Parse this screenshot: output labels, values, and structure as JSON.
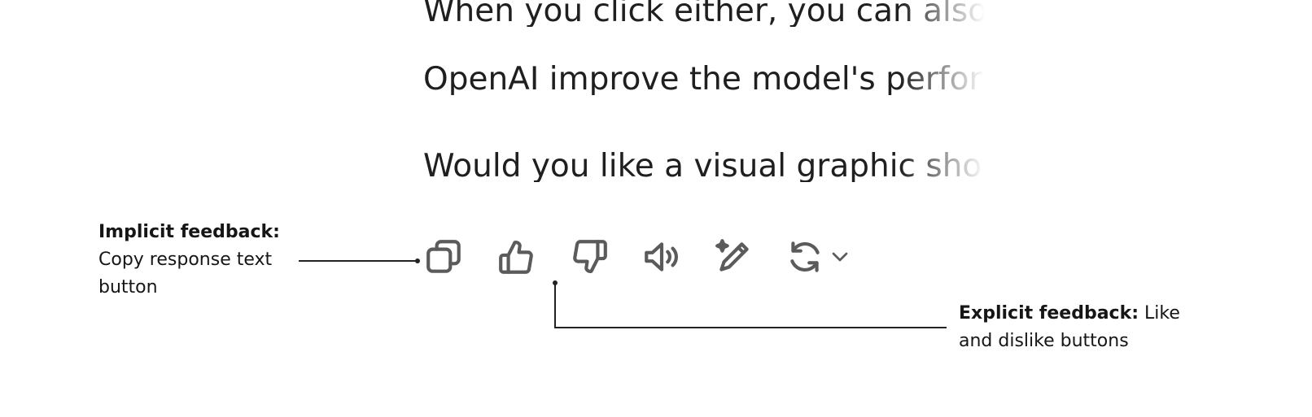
{
  "response": {
    "lines": [
      "When you click either, you can also give",
      "OpenAI improve the model's performance.",
      "Would you like a visual graphic showing"
    ]
  },
  "actions": {
    "icons": [
      "copy-icon",
      "thumbs-up-icon",
      "thumbs-down-icon",
      "speaker-icon",
      "sparkle-edit-icon",
      "regenerate-icon",
      "chevron-down-icon"
    ],
    "icon_color": "#5b5b5b"
  },
  "annotations": {
    "implicit": {
      "title": "Implicit feedback:",
      "body": "Copy response text button"
    },
    "explicit": {
      "title": "Explicit feedback:",
      "body": "Like and dislike buttons"
    }
  }
}
